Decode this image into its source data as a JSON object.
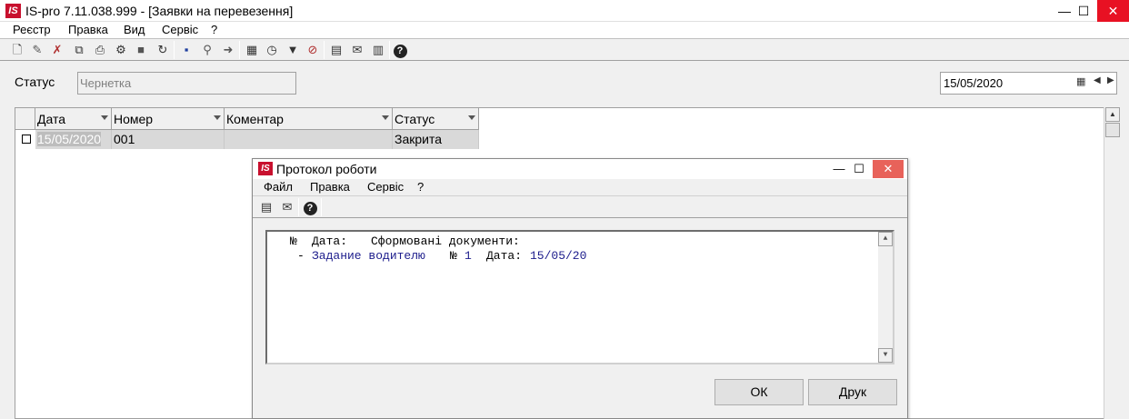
{
  "window": {
    "logo_text": "IS",
    "title": "IS-pro 7.11.038.999 - [Заявки на перевезення]",
    "min_glyph": "—",
    "max_glyph": "☐",
    "close_glyph": "✕"
  },
  "menu": [
    "Реєстр",
    "Правка",
    "Вид",
    "Сервіс",
    "?"
  ],
  "toolbar_icons": [
    "new-doc-icon",
    "edit-icon",
    "delete-icon",
    "copy-icon",
    "print-icon",
    "settings-icon",
    "folder-icon",
    "refresh-icon",
    "save-icon",
    "search-icon",
    "find-next-icon",
    "table-icon",
    "calculator-icon",
    "filter-icon",
    "clear-filter-icon",
    "report-icon",
    "mail-icon",
    "columns-icon",
    "help-icon"
  ],
  "filters": {
    "status_label": "Статус",
    "status_placeholder": "Чернетка",
    "date_value": "15/05/2020"
  },
  "grid": {
    "columns": [
      "Дата",
      "Номер",
      "Коментар",
      "Статус"
    ],
    "rows": [
      {
        "date": "15/05/2020",
        "number": "001",
        "comment": "",
        "status": "Закрита"
      }
    ]
  },
  "dialog": {
    "logo_text": "IS",
    "title": "Протокол роботи",
    "menu": [
      "Файл",
      "Правка",
      "Сервіс",
      "?"
    ],
    "log": {
      "header_no": "№",
      "header_date": "Дата:",
      "header_docs": "Сформовані документи:",
      "item_dash": "-",
      "item_name": "Задание водителю",
      "item_no_label": "№",
      "item_no": "1",
      "item_date_label": "Дата:",
      "item_date": "15/05/20"
    },
    "ok_label": "ОК",
    "print_label": "Друк"
  },
  "colors": {
    "accent_red": "#c8102e",
    "close_red": "#e81123",
    "log_blue": "#1c1c8c"
  }
}
